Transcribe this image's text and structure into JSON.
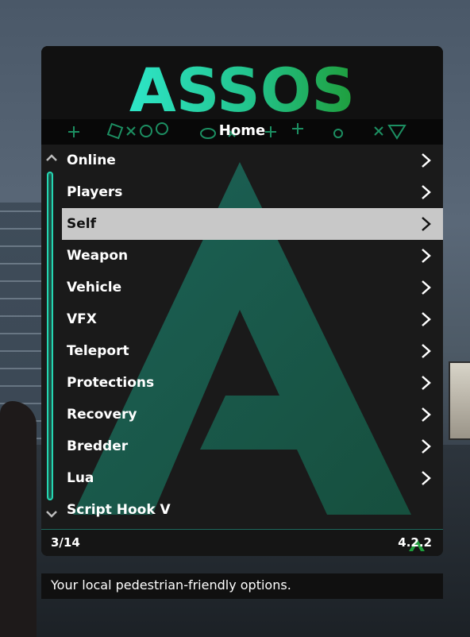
{
  "menu": {
    "logo_text": "ASSOS",
    "subtitle": "Home",
    "items": [
      {
        "label": "Online",
        "has_submenu": true
      },
      {
        "label": "Players",
        "has_submenu": true
      },
      {
        "label": "Self",
        "has_submenu": true,
        "selected": true
      },
      {
        "label": "Weapon",
        "has_submenu": true
      },
      {
        "label": "Vehicle",
        "has_submenu": true
      },
      {
        "label": "VFX",
        "has_submenu": true
      },
      {
        "label": "Teleport",
        "has_submenu": true
      },
      {
        "label": "Protections",
        "has_submenu": true
      },
      {
        "label": "Recovery",
        "has_submenu": true
      },
      {
        "label": "Bredder",
        "has_submenu": true
      },
      {
        "label": "Lua",
        "has_submenu": true
      },
      {
        "label": "Script Hook V",
        "has_submenu": false
      }
    ],
    "footer": {
      "position": "3/14",
      "version": "4.2.2"
    },
    "description": "Your local pedestrian-friendly options."
  },
  "colors": {
    "accent_teal": "#25d6b2",
    "accent_green": "#27b04a",
    "selected_bg": "#c8c8c8"
  },
  "icons": {
    "scroll_up": "chevron-up-icon",
    "scroll_down": "chevron-down-icon",
    "submenu": "chevron-right-icon",
    "footer": "assos-logo-icon"
  }
}
